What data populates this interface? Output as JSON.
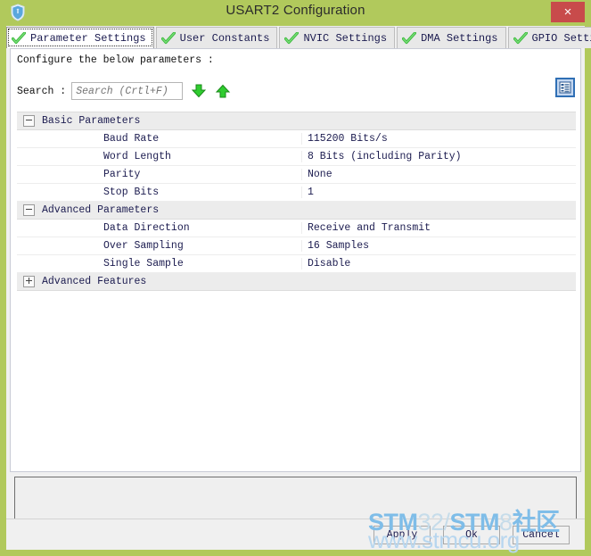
{
  "window": {
    "title": "USART2 Configuration",
    "app_icon": "shield-icon",
    "close_label": "×"
  },
  "tabs": [
    {
      "label": "Parameter Settings",
      "icon": "green-check-icon",
      "active": true
    },
    {
      "label": "User Constants",
      "icon": "green-check-icon",
      "active": false
    },
    {
      "label": "NVIC Settings",
      "icon": "green-check-icon",
      "active": false
    },
    {
      "label": "DMA Settings",
      "icon": "green-check-icon",
      "active": false
    },
    {
      "label": "GPIO Settings",
      "icon": "green-check-icon",
      "active": false
    }
  ],
  "content": {
    "instruction": "Configure the below parameters :",
    "search": {
      "label": "Search :",
      "value": "",
      "placeholder": "Search (Crtl+F)"
    },
    "find_next_icon": "down-arrow-icon",
    "find_prev_icon": "up-arrow-icon",
    "list_view_icon": "list-view-icon"
  },
  "groups": [
    {
      "title": "Basic Parameters",
      "expanded": true,
      "rows": [
        {
          "name": "Baud Rate",
          "value": "115200 Bits/s"
        },
        {
          "name": "Word Length",
          "value": "8 Bits (including Parity)"
        },
        {
          "name": "Parity",
          "value": "None"
        },
        {
          "name": "Stop Bits",
          "value": "1"
        }
      ]
    },
    {
      "title": "Advanced Parameters",
      "expanded": true,
      "rows": [
        {
          "name": "Data Direction",
          "value": "Receive and Transmit"
        },
        {
          "name": "Over Sampling",
          "value": "16 Samples"
        },
        {
          "name": "Single Sample",
          "value": "Disable"
        }
      ]
    },
    {
      "title": "Advanced Features",
      "expanded": false,
      "rows": []
    }
  ],
  "buttons": {
    "apply": "Apply",
    "ok": "Ok",
    "cancel": "Cancel"
  },
  "watermark": {
    "line1_a": "STM",
    "line1_b": "32/",
    "line1_c": "STM",
    "line1_d": "8",
    "line1_e": "社区",
    "line2": "www.stmcu.org"
  },
  "colors": {
    "titlebar": "#b1c95c",
    "close": "#c84b4b",
    "accent_blue": "#2f6fb5",
    "check_green": "#3fbb3f",
    "watermark_blue": "#7fbde8"
  }
}
